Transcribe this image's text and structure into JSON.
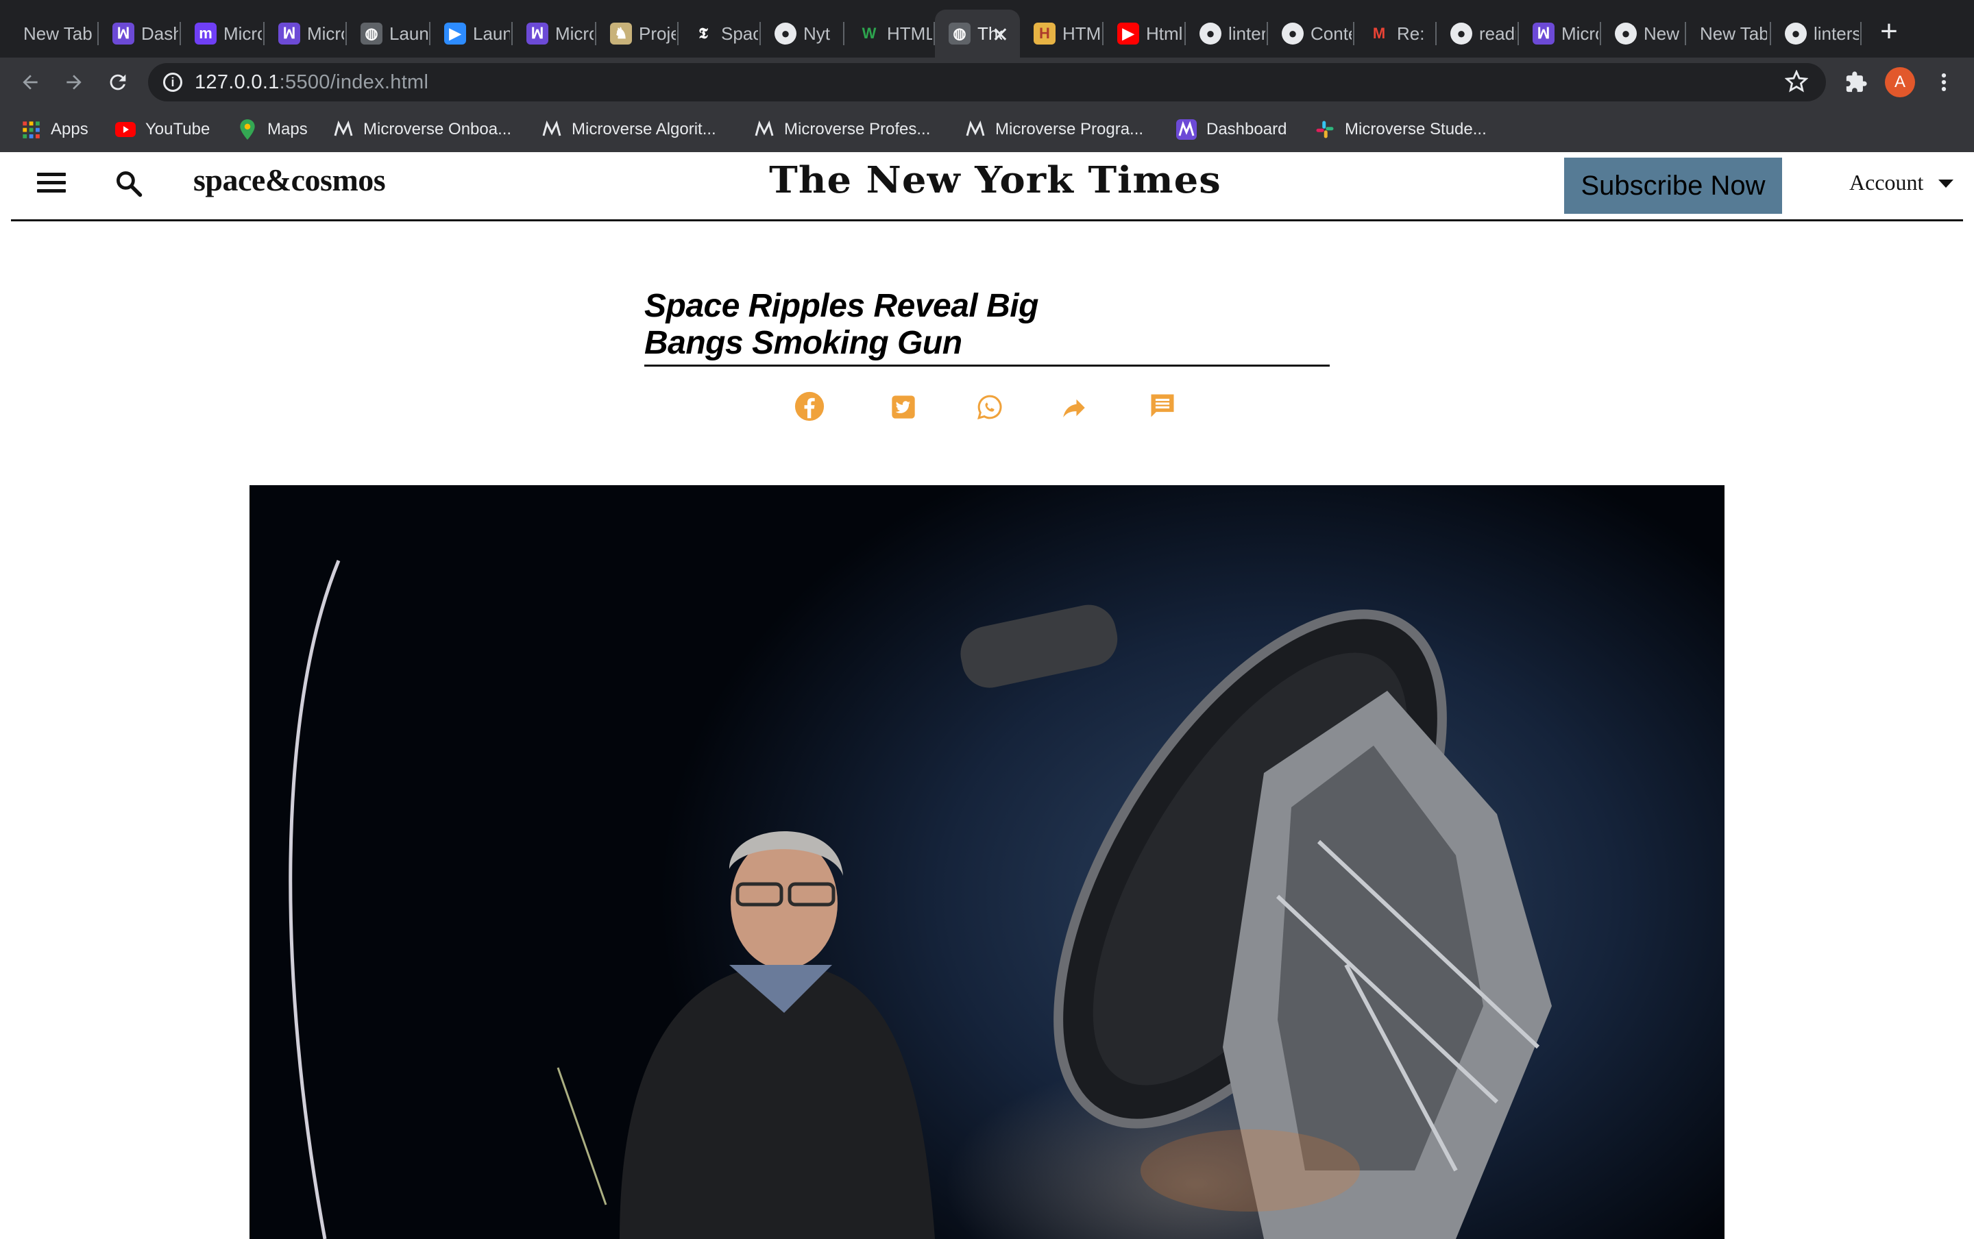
{
  "browser": {
    "tabs": [
      {
        "title": "New Tab",
        "icon": "none"
      },
      {
        "title": "Dashboard",
        "icon": "microverse-icon"
      },
      {
        "title": "Microverse",
        "icon": "m-icon"
      },
      {
        "title": "Microverse",
        "icon": "microverse-icon"
      },
      {
        "title": "Launch",
        "icon": "globe-icon"
      },
      {
        "title": "Launch",
        "icon": "zoom-icon"
      },
      {
        "title": "Microverse",
        "icon": "microverse-icon"
      },
      {
        "title": "Project",
        "icon": "project-icon"
      },
      {
        "title": "Space",
        "icon": "nyt-icon"
      },
      {
        "title": "Nyt",
        "icon": "github-icon"
      },
      {
        "title": "HTML",
        "icon": "w-icon"
      },
      {
        "title": "The New York Times",
        "icon": "globe-icon",
        "active": true
      },
      {
        "title": "HTML",
        "icon": "h-icon"
      },
      {
        "title": "Html",
        "icon": "youtube-icon"
      },
      {
        "title": "linters",
        "icon": "github-icon"
      },
      {
        "title": "Contents",
        "icon": "github-icon"
      },
      {
        "title": "Re:",
        "icon": "gmail-icon"
      },
      {
        "title": "readme",
        "icon": "github-icon"
      },
      {
        "title": "Microverse",
        "icon": "microverse-icon"
      },
      {
        "title": "New",
        "icon": "github-icon"
      },
      {
        "title": "New Tab",
        "icon": "none"
      },
      {
        "title": "linters",
        "icon": "github-icon"
      }
    ],
    "url_host": "127.0.0.1",
    "url_rest": ":5500/index.html",
    "profile_initial": "A",
    "bookmarks": [
      {
        "label": "Apps",
        "icon": "apps-grid-icon"
      },
      {
        "label": "YouTube",
        "icon": "youtube-icon"
      },
      {
        "label": "Maps",
        "icon": "maps-pin-icon"
      },
      {
        "label": "Microverse Onboa...",
        "icon": "microverse-icon"
      },
      {
        "label": "Microverse Algorit...",
        "icon": "microverse-icon"
      },
      {
        "label": "Microverse Profes...",
        "icon": "microverse-icon"
      },
      {
        "label": "Microverse Progra...",
        "icon": "microverse-icon"
      },
      {
        "label": "Dashboard",
        "icon": "microverse-icon"
      },
      {
        "label": "Microverse Stude...",
        "icon": "slack-icon"
      }
    ]
  },
  "site": {
    "section": "space&cosmos",
    "logo": "The New York Times",
    "subscribe_label": "Subscribe Now",
    "account_label": "Account"
  },
  "article": {
    "headline": "Space Ripples Reveal Big Bangs Smoking Gun",
    "share_icons": [
      "facebook-icon",
      "twitter-icon",
      "whatsapp-icon",
      "share-arrow-icon",
      "comment-icon"
    ]
  },
  "colors": {
    "chrome_dark": "#202124",
    "chrome_toolbar": "#35363a",
    "subscribe_bg": "#567b95",
    "share_orange": "#f0a23b",
    "profile": "#e2582b"
  }
}
